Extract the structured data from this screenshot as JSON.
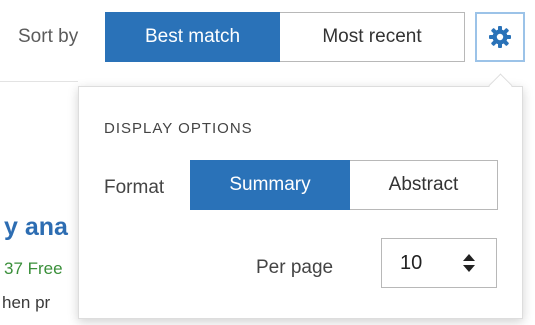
{
  "sort": {
    "label": "Sort by",
    "options": [
      {
        "label": "Best match",
        "active": true
      },
      {
        "label": "Most recent",
        "active": false
      }
    ]
  },
  "settings_button": {
    "icon": "gear-icon"
  },
  "background_result": {
    "title_fragment": "y ana",
    "meta_fragment": "37 Free",
    "authors_fragment": "hen pr"
  },
  "display_options": {
    "heading": "DISPLAY OPTIONS",
    "format": {
      "label": "Format",
      "options": [
        {
          "label": "Summary",
          "active": true
        },
        {
          "label": "Abstract",
          "active": false
        }
      ]
    },
    "per_page": {
      "label": "Per page",
      "value": "10",
      "icon": "sort-arrows-icon"
    }
  },
  "colors": {
    "accent": "#2a72b8",
    "result_link": "#2d6db2",
    "result_meta": "#3a8f3a"
  }
}
